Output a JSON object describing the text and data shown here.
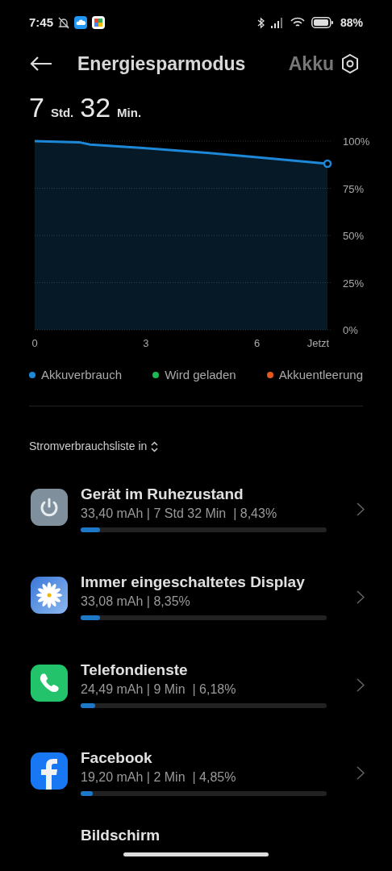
{
  "status_bar": {
    "time": "7:45",
    "battery": "88%"
  },
  "header": {
    "tabs": [
      {
        "label": "Energiesparmodus",
        "selected": true
      },
      {
        "label": "Akku",
        "selected": false
      }
    ]
  },
  "remaining": [
    {
      "value": "7",
      "unit": "Std."
    },
    {
      "value": "32",
      "unit": "Min."
    }
  ],
  "chart": {
    "chart_data": {
      "type": "area",
      "x": [
        0,
        1.2,
        1.5,
        3,
        4.5,
        6,
        7.9
      ],
      "series": [
        {
          "name": "Akkuverbrauch",
          "color": "#1e88d8",
          "values": [
            100,
            99.4,
            98.2,
            96.3,
            94,
            91.5,
            88
          ]
        }
      ],
      "xticks": [
        0,
        3,
        6,
        {
          "value": 7.65,
          "label": "Jetzt"
        }
      ],
      "xlim": [
        0,
        7.9
      ],
      "yticks": [
        {
          "value": 0,
          "label": "0%"
        },
        {
          "value": 25,
          "label": "25%"
        },
        {
          "value": 50,
          "label": "50%"
        },
        {
          "value": 75,
          "label": "75%"
        },
        {
          "value": 100,
          "label": "100%"
        }
      ],
      "ylim": [
        0,
        100
      ],
      "grid": true
    }
  },
  "legend": [
    {
      "label": "Wird geladen",
      "color": "#1db954"
    },
    {
      "label": "Akkuentleerung",
      "color": "#e4581f"
    }
  ],
  "list_header": "Stromverbrauchsliste in",
  "apps": [
    {
      "kind": "power",
      "name": "Gerät im Ruhezustand",
      "details": "33,40 mAh | 7 Std 32 Min  | 8,43%",
      "level": 0.08
    },
    {
      "kind": "display",
      "name": "Immer eingeschaltetes Display",
      "details": "33,08 mAh | 8,35%",
      "level": 0.08
    },
    {
      "kind": "phone",
      "name": "Telefondienste",
      "details": "24,49 mAh | 9 Min  | 6,18%",
      "level": 0.06
    },
    {
      "kind": "facebook",
      "name": "Facebook",
      "details": "19,20 mAh | 2 Min  | 4,85%",
      "level": 0.05
    },
    {
      "kind": "cut_off",
      "name": "Bildschirm"
    }
  ]
}
